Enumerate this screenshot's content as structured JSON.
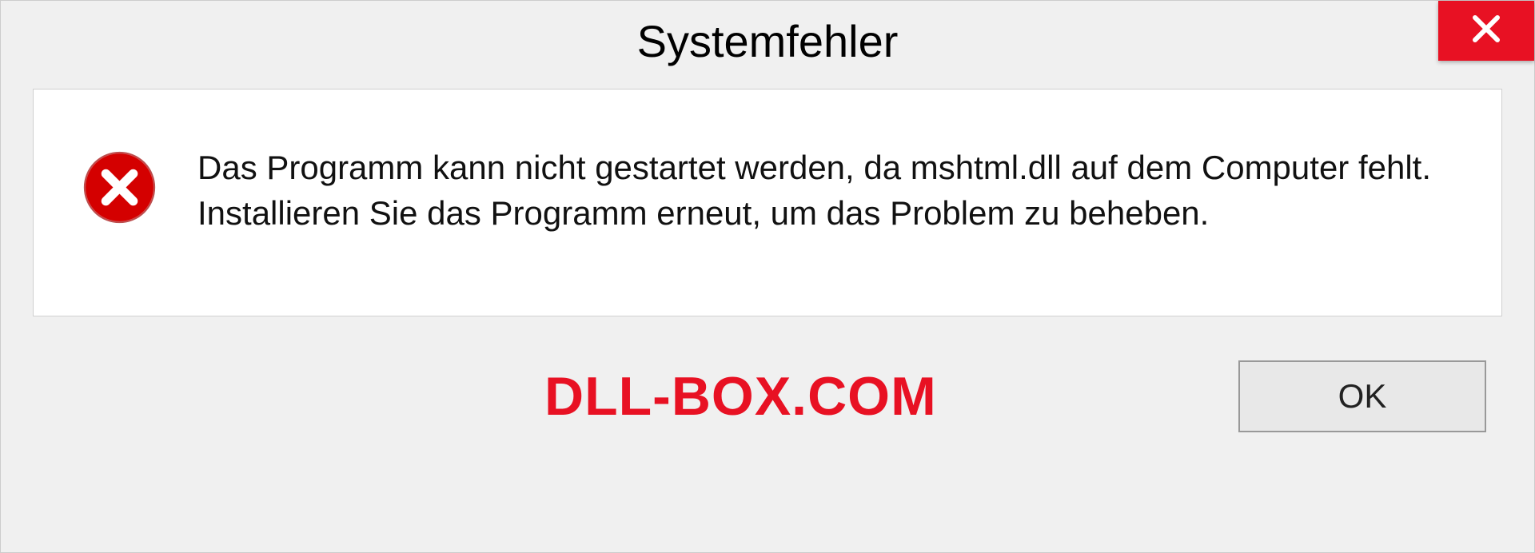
{
  "dialog": {
    "title": "Systemfehler",
    "message": "Das Programm kann nicht gestartet werden, da mshtml.dll auf dem Computer fehlt. Installieren Sie das Programm erneut, um das Problem zu beheben.",
    "ok_label": "OK"
  },
  "watermark": "DLL-BOX.COM",
  "colors": {
    "error_red": "#e81123",
    "close_red": "#e81123"
  }
}
